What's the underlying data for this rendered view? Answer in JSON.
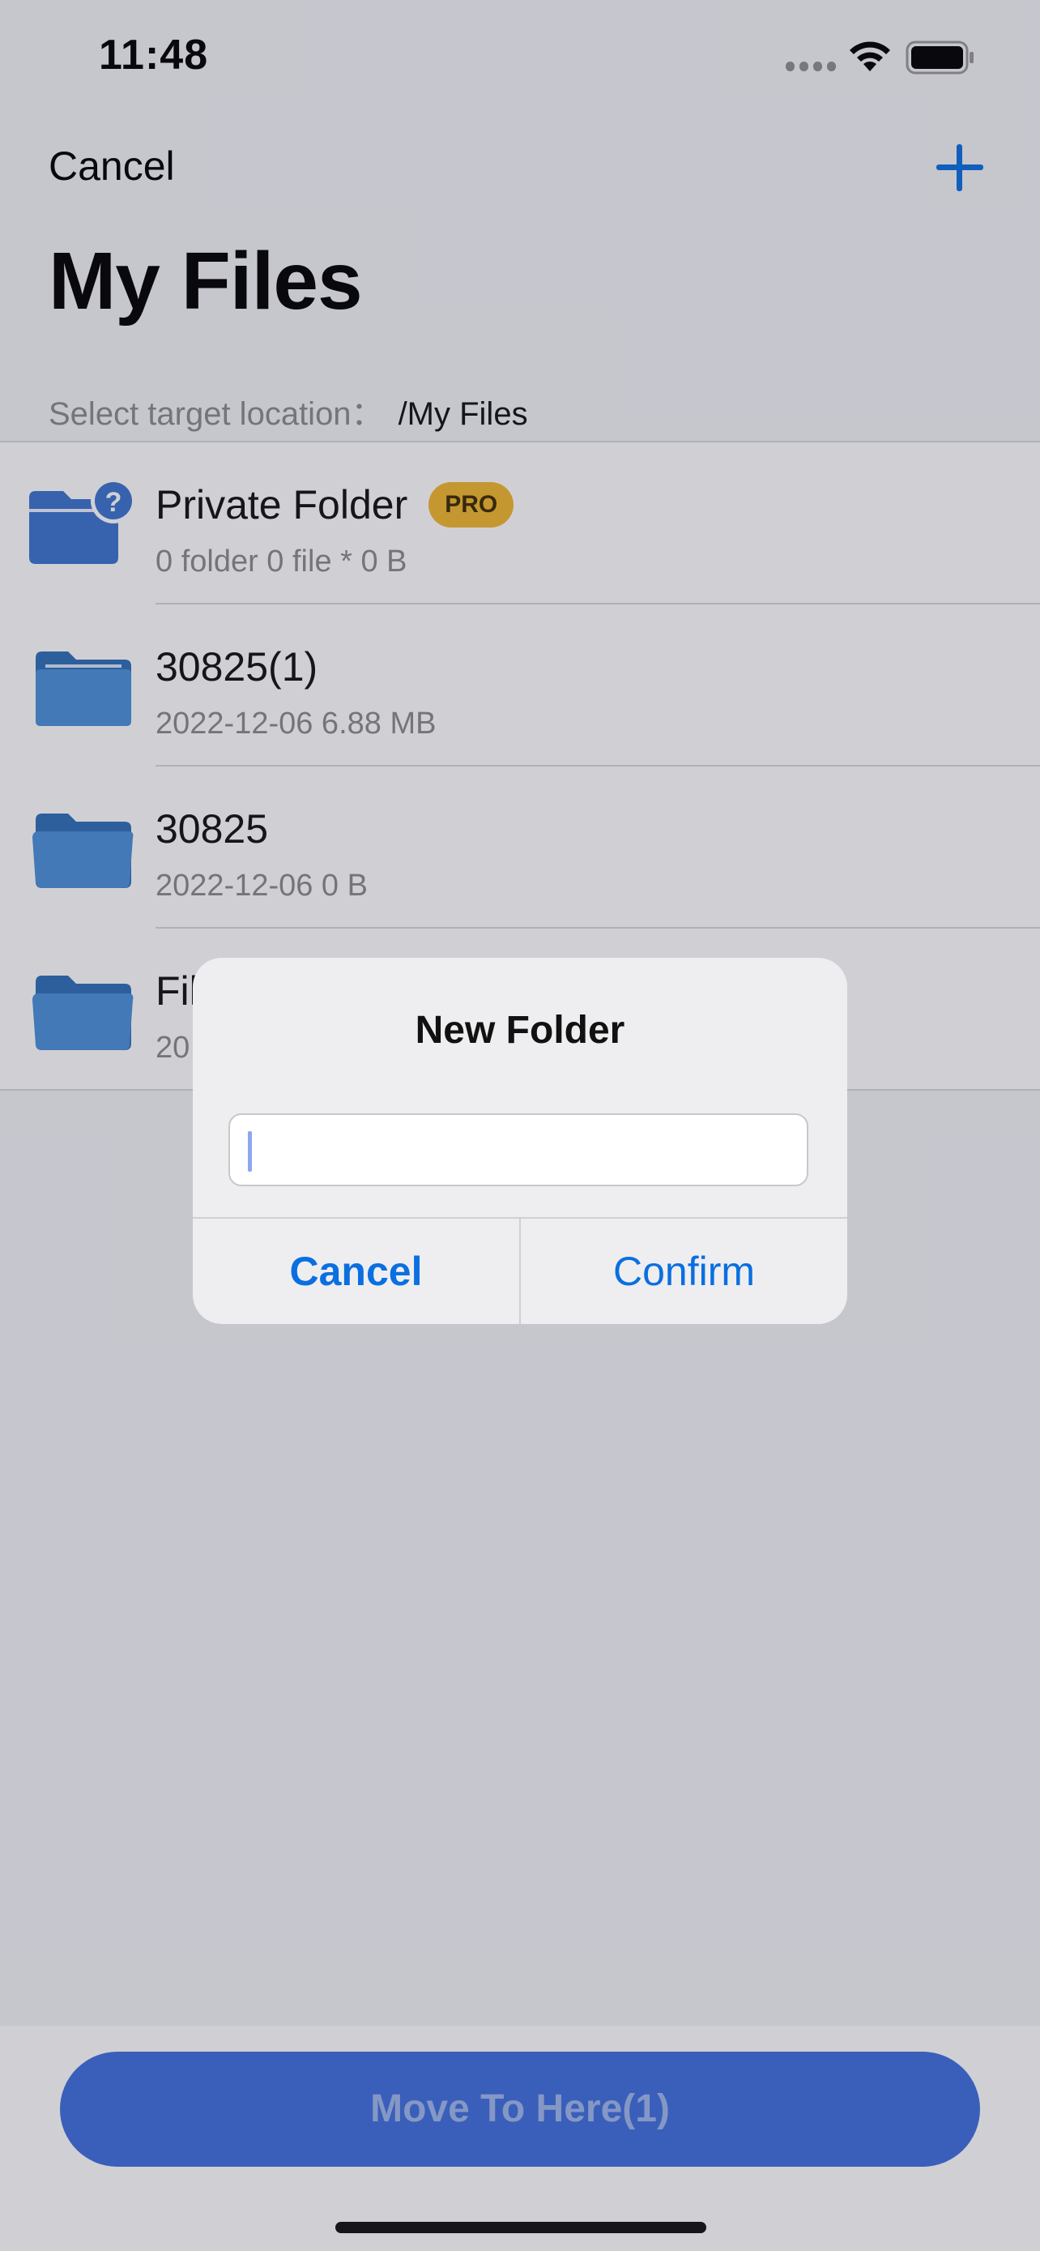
{
  "status_bar": {
    "time": "11:48"
  },
  "nav": {
    "cancel_label": "Cancel"
  },
  "page_title": "My Files",
  "target": {
    "label": "Select target location：",
    "path": "/My Files"
  },
  "files": [
    {
      "name": "Private Folder",
      "badge": "PRO",
      "meta": "0 folder 0 file * 0 B",
      "icon": "private-folder-icon"
    },
    {
      "name": "30825(1)",
      "meta": "2022-12-06 6.88 MB",
      "icon": "folder-icon"
    },
    {
      "name": "30825",
      "meta": "2022-12-06 0 B",
      "icon": "folder-icon"
    },
    {
      "name": "Fil",
      "meta": "20",
      "icon": "folder-icon"
    }
  ],
  "bottom": {
    "move_button_label": "Move To Here(1)"
  },
  "alert": {
    "title": "New Folder",
    "input_value": "",
    "cancel_label": "Cancel",
    "confirm_label": "Confirm"
  },
  "colors": {
    "accent": "#0a6fe0",
    "pro_badge": "#f0b72f",
    "folder": "#3e86d0",
    "move_button": "#3f6fde"
  }
}
